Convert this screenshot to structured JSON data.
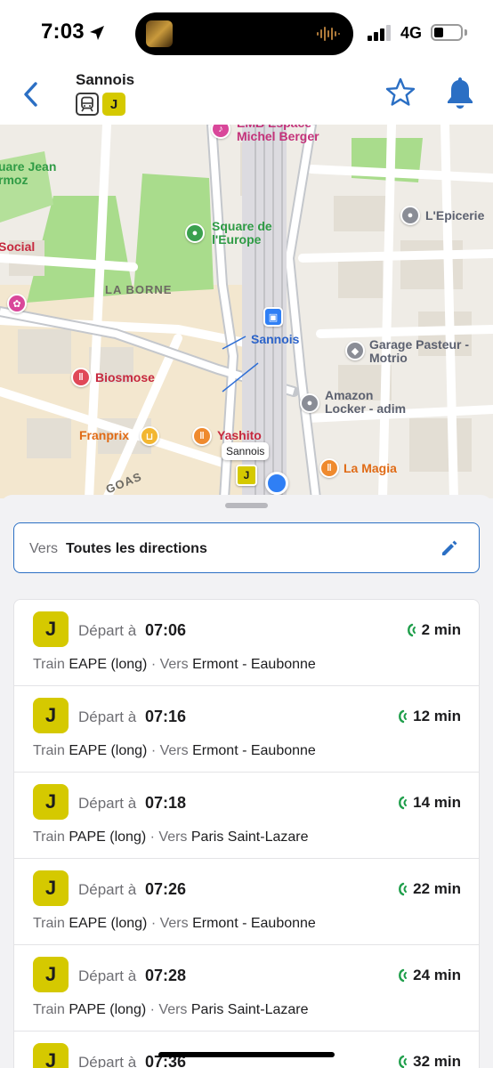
{
  "status_bar": {
    "time": "7:03",
    "network": "4G",
    "battery_level": 0.35
  },
  "header": {
    "station": "Sannois",
    "line_badge": "J",
    "back_icon": "chevron-left-icon",
    "favorite_icon": "star-icon",
    "alert_icon": "bell-icon"
  },
  "map": {
    "labels": {
      "emb": "EMB Espace\nMichel Berger",
      "square_jean": "uare Jean\nrmoz",
      "square_europe": "Square de\nl'Europe",
      "epicerie": "L'Epicerie",
      "social": "Social",
      "la_borne": "LA BORNE",
      "sannois": "Sannois",
      "garage": "Garage Pasteur -\nMotrio",
      "biosmose": "Biosmose",
      "amazon": "Amazon\nLocker - adim",
      "franprix": "Franprix",
      "yashito": "Yashito",
      "la_magia": "La Magia",
      "goas": "GOAS"
    },
    "callout": "Sannois",
    "pin_badge": "J"
  },
  "direction": {
    "prefix": "Vers",
    "value": "Toutes les directions",
    "edit_icon": "pencil-icon"
  },
  "departures": [
    {
      "line": "J",
      "prefix": "Départ à",
      "time": "07:06",
      "wait": "2 min",
      "mode": "Train",
      "code": "EAPE (long)",
      "sep": "·",
      "vers": "Vers",
      "destination": "Ermont - Eaubonne"
    },
    {
      "line": "J",
      "prefix": "Départ à",
      "time": "07:16",
      "wait": "12 min",
      "mode": "Train",
      "code": "EAPE (long)",
      "sep": "·",
      "vers": "Vers",
      "destination": "Ermont - Eaubonne"
    },
    {
      "line": "J",
      "prefix": "Départ à",
      "time": "07:18",
      "wait": "14 min",
      "mode": "Train",
      "code": "PAPE (long)",
      "sep": "·",
      "vers": "Vers",
      "destination": "Paris Saint-Lazare"
    },
    {
      "line": "J",
      "prefix": "Départ à",
      "time": "07:26",
      "wait": "22 min",
      "mode": "Train",
      "code": "EAPE (long)",
      "sep": "·",
      "vers": "Vers",
      "destination": "Ermont - Eaubonne"
    },
    {
      "line": "J",
      "prefix": "Départ à",
      "time": "07:28",
      "wait": "24 min",
      "mode": "Train",
      "code": "PAPE (long)",
      "sep": "·",
      "vers": "Vers",
      "destination": "Paris Saint-Lazare"
    },
    {
      "line": "J",
      "prefix": "Départ à",
      "time": "07:36",
      "wait": "32 min",
      "mode": "",
      "code": "",
      "sep": "",
      "vers": "",
      "destination": ""
    }
  ],
  "colors": {
    "accent": "#2b6fc4",
    "line_j": "#d5c900",
    "realtime": "#1e9e4a"
  }
}
